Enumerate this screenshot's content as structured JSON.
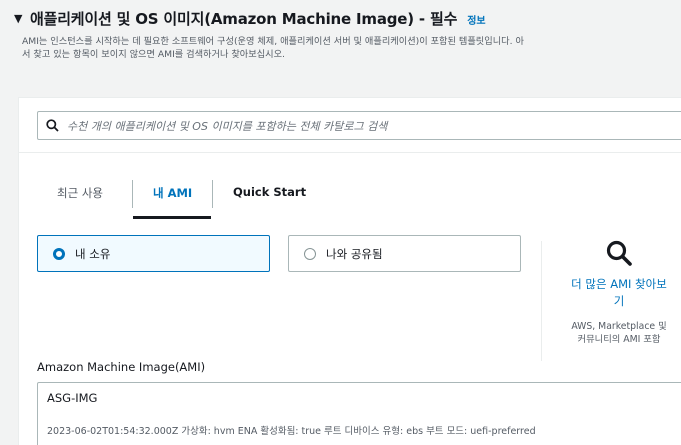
{
  "section": {
    "title": "애플리케이션 및 OS 이미지(Amazon Machine Image) - 필수",
    "info_link": "정보",
    "description_line1": "AMI는 인스턴스를 시작하는 데 필요한 소프트웨어 구성(운영 체제, 애플리케이션 서버 및 애플리케이션)이 포함된 템플릿입니다. 아",
    "description_line2": "서 찾고 있는 항목이 보이지 않으면 AMI를 검색하거나 찾아보십시오."
  },
  "search": {
    "placeholder": "수천 개의 애플리케이션 및 OS 이미지를 포함하는 전체 카탈로그 검색"
  },
  "tabs": [
    {
      "label": "최근 사용",
      "active": false
    },
    {
      "label": "내 AMI",
      "active": true
    },
    {
      "label": "Quick Start",
      "active": false
    }
  ],
  "ownership": {
    "option_owned": "내 소유",
    "option_shared": "나와 공유됨",
    "selected": "내 소유"
  },
  "browse_more": {
    "link_line1": "더 많은 AMI 찾아보",
    "link_line2": "기",
    "sub_line1": "AWS, Marketplace 및",
    "sub_line2": "커뮤니티의 AMI 포함"
  },
  "ami": {
    "label": "Amazon Machine Image(AMI)",
    "name": "ASG-IMG",
    "meta": "2023-06-02T01:54:32.000Z    가상화: hvm    ENA 활성화됨: true    루트 디바이스 유형: ebs    부트 모드: uefi-preferred"
  },
  "colors": {
    "link": "#0073bb",
    "border": "#aab7b8",
    "background": "#f2f3f3"
  }
}
